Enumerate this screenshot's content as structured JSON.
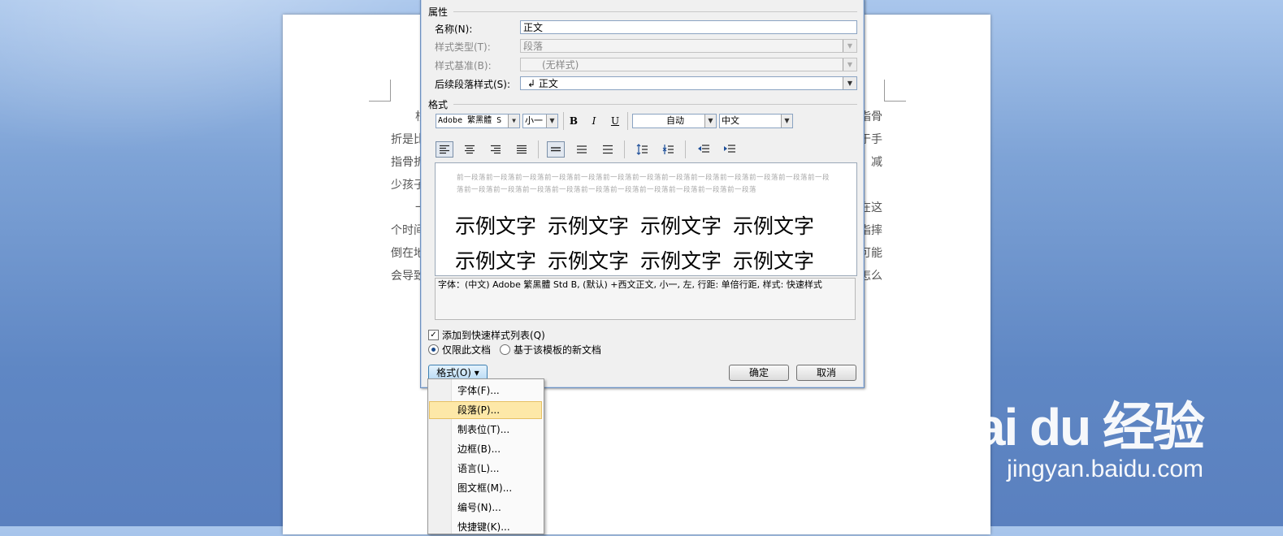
{
  "document": {
    "left_lines": [
      "根",
      "折是比",
      "指骨折",
      "少孩子",
      "一",
      "个时间",
      "倒在地",
      "会导致"
    ],
    "right_lines": [
      "指骨",
      "于手",
      "，减",
      "",
      "在这",
      "指摔",
      "可能",
      "怎么"
    ]
  },
  "dialog": {
    "properties_label": "属性",
    "name_label": "名称(N):",
    "name_value": "正文",
    "style_type_label": "样式类型(T):",
    "style_type_value": "段落",
    "based_on_label": "样式基准(B):",
    "based_on_value": "(无样式)",
    "next_style_label": "后续段落样式(S):",
    "next_style_value": "↲ 正文",
    "format_label": "格式",
    "toolbar": {
      "font": "Adobe 繁黑體 S",
      "size": "小一",
      "bold": "B",
      "italic": "I",
      "underline": "U",
      "color": "自动",
      "script": "中文"
    },
    "preview": {
      "prev_paragraph": "前一段落前一段落前一段落前一段落前一段落前一段落前一段落前一段落前一段落前一段落前一段落前一段落前一段落前一段落前一段落前一段落前一段落前一段落前一段落前一段落前一段落前一段落前一段落",
      "sample_text": "示例文字"
    },
    "description": "字体：(中文) Adobe 繁黑體 Std B, (默认) +西文正文, 小一, 左, 行距: 单倍行距, 样式: 快速样式",
    "add_to_quick_styles": "添加到快速样式列表(Q)",
    "only_this_doc": "仅限此文档",
    "new_docs_template": "基于该模板的新文档",
    "format_button": "格式(O) ▾",
    "ok_button": "确定",
    "cancel_button": "取消"
  },
  "menu": {
    "items": [
      "字体(F)...",
      "段落(P)...",
      "制表位(T)...",
      "边框(B)...",
      "语言(L)...",
      "图文框(M)...",
      "编号(N)...",
      "快捷键(K)..."
    ]
  },
  "watermark": {
    "main": "Bai du 经验",
    "sub": "jingyan.baidu.com"
  }
}
